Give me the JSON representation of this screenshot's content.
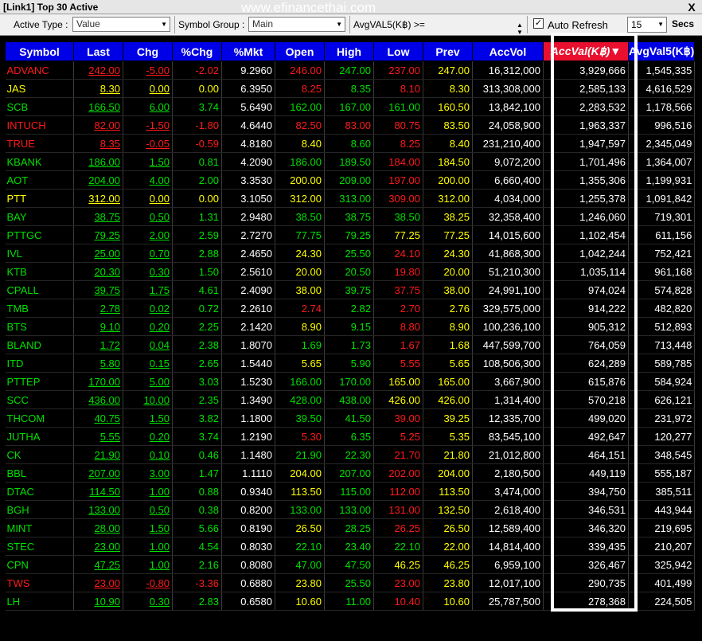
{
  "window": {
    "title": "[Link1] Top 30 Active",
    "watermark": "www.efinancethai.com",
    "close_label": "X"
  },
  "toolbar": {
    "active_type_label": "Active Type :",
    "active_type_value": "Value",
    "symbol_group_label": "Symbol Group :",
    "symbol_group_value": "Main",
    "avgval_label": "AvgVAL5(K฿) >=",
    "auto_refresh_label": "Auto Refresh",
    "auto_refresh_checked": "✓",
    "refresh_secs_value": "15",
    "secs_label": "Secs"
  },
  "colors": {
    "up": "#00e000",
    "down": "#ff1a1a",
    "unchanged": "#ffff00",
    "header_bg": "#0000e6",
    "selected_header_bg": "#e8102e"
  },
  "table": {
    "columns": [
      "Symbol",
      "Last",
      "Chg",
      "%Chg",
      "%Mkt",
      "Open",
      "High",
      "Low",
      "Prev",
      "AccVol",
      "AccVal(K฿)",
      "AvgVal5(K฿)"
    ],
    "sorted_column_arrow": "▼",
    "rows": [
      {
        "symbol": "ADVANC",
        "last": "242.00",
        "chg": "-5.00",
        "pchg": "-2.02",
        "pmkt": "9.2960",
        "open": "246.00",
        "high": "247.00",
        "low": "237.00",
        "prev": "247.00",
        "accvol": "16,312,000",
        "accval": "3,929,666",
        "avgval5": "1,545,335",
        "c": {
          "symbol": "d",
          "last": "d",
          "open": "d",
          "high": "u",
          "low": "d"
        }
      },
      {
        "symbol": "JAS",
        "last": "8.30",
        "chg": "0.00",
        "pchg": "0.00",
        "pmkt": "6.3950",
        "open": "8.25",
        "high": "8.35",
        "low": "8.10",
        "prev": "8.30",
        "accvol": "313,308,000",
        "accval": "2,585,133",
        "avgval5": "4,616,529",
        "c": {
          "symbol": "n",
          "last": "n",
          "open": "d",
          "high": "g",
          "low": "d"
        }
      },
      {
        "symbol": "SCB",
        "last": "166.50",
        "chg": "6.00",
        "pchg": "3.74",
        "pmkt": "5.6490",
        "open": "162.00",
        "high": "167.00",
        "low": "161.00",
        "prev": "160.50",
        "accvol": "13,842,100",
        "accval": "2,283,532",
        "avgval5": "1,178,566",
        "c": {
          "symbol": "g",
          "last": "g",
          "open": "g",
          "high": "g",
          "low": "g"
        }
      },
      {
        "symbol": "INTUCH",
        "last": "82.00",
        "chg": "-1.50",
        "pchg": "-1.80",
        "pmkt": "4.6440",
        "open": "82.50",
        "high": "83.00",
        "low": "80.75",
        "prev": "83.50",
        "accvol": "24,058,900",
        "accval": "1,963,337",
        "avgval5": "996,516",
        "c": {
          "symbol": "d",
          "last": "d",
          "open": "d",
          "high": "d",
          "low": "d"
        }
      },
      {
        "symbol": "TRUE",
        "last": "8.35",
        "chg": "-0.05",
        "pchg": "-0.59",
        "pmkt": "4.8180",
        "open": "8.40",
        "high": "8.60",
        "low": "8.25",
        "prev": "8.40",
        "accvol": "231,210,400",
        "accval": "1,947,597",
        "avgval5": "2,345,049",
        "c": {
          "symbol": "d",
          "last": "d",
          "open": "n",
          "high": "g",
          "low": "d"
        }
      },
      {
        "symbol": "KBANK",
        "last": "186.00",
        "chg": "1.50",
        "pchg": "0.81",
        "pmkt": "4.2090",
        "open": "186.00",
        "high": "189.50",
        "low": "184.00",
        "prev": "184.50",
        "accvol": "9,072,200",
        "accval": "1,701,496",
        "avgval5": "1,364,007",
        "c": {
          "symbol": "g",
          "last": "g",
          "open": "g",
          "high": "g",
          "low": "d"
        }
      },
      {
        "symbol": "AOT",
        "last": "204.00",
        "chg": "4.00",
        "pchg": "2.00",
        "pmkt": "3.3530",
        "open": "200.00",
        "high": "209.00",
        "low": "197.00",
        "prev": "200.00",
        "accvol": "6,660,400",
        "accval": "1,355,306",
        "avgval5": "1,199,931",
        "c": {
          "symbol": "g",
          "last": "g",
          "open": "n",
          "high": "g",
          "low": "d"
        }
      },
      {
        "symbol": "PTT",
        "last": "312.00",
        "chg": "0.00",
        "pchg": "0.00",
        "pmkt": "3.1050",
        "open": "312.00",
        "high": "313.00",
        "low": "309.00",
        "prev": "312.00",
        "accvol": "4,034,000",
        "accval": "1,255,378",
        "avgval5": "1,091,842",
        "c": {
          "symbol": "n",
          "last": "n",
          "open": "n",
          "high": "g",
          "low": "d"
        }
      },
      {
        "symbol": "BAY",
        "last": "38.75",
        "chg": "0.50",
        "pchg": "1.31",
        "pmkt": "2.9480",
        "open": "38.50",
        "high": "38.75",
        "low": "38.50",
        "prev": "38.25",
        "accvol": "32,358,400",
        "accval": "1,246,060",
        "avgval5": "719,301",
        "c": {
          "symbol": "g",
          "last": "g",
          "open": "g",
          "high": "g",
          "low": "g"
        }
      },
      {
        "symbol": "PTTGC",
        "last": "79.25",
        "chg": "2.00",
        "pchg": "2.59",
        "pmkt": "2.7270",
        "open": "77.75",
        "high": "79.25",
        "low": "77.25",
        "prev": "77.25",
        "accvol": "14,015,600",
        "accval": "1,102,454",
        "avgval5": "611,156",
        "c": {
          "symbol": "g",
          "last": "g",
          "open": "g",
          "high": "g",
          "low": "n"
        }
      },
      {
        "symbol": "IVL",
        "last": "25.00",
        "chg": "0.70",
        "pchg": "2.88",
        "pmkt": "2.4650",
        "open": "24.30",
        "high": "25.50",
        "low": "24.10",
        "prev": "24.30",
        "accvol": "41,868,300",
        "accval": "1,042,244",
        "avgval5": "752,421",
        "c": {
          "symbol": "g",
          "last": "g",
          "open": "n",
          "high": "g",
          "low": "d"
        }
      },
      {
        "symbol": "KTB",
        "last": "20.30",
        "chg": "0.30",
        "pchg": "1.50",
        "pmkt": "2.5610",
        "open": "20.00",
        "high": "20.50",
        "low": "19.80",
        "prev": "20.00",
        "accvol": "51,210,300",
        "accval": "1,035,114",
        "avgval5": "961,168",
        "c": {
          "symbol": "g",
          "last": "g",
          "open": "n",
          "high": "g",
          "low": "d"
        }
      },
      {
        "symbol": "CPALL",
        "last": "39.75",
        "chg": "1.75",
        "pchg": "4.61",
        "pmkt": "2.4090",
        "open": "38.00",
        "high": "39.75",
        "low": "37.75",
        "prev": "38.00",
        "accvol": "24,991,100",
        "accval": "974,024",
        "avgval5": "574,828",
        "c": {
          "symbol": "g",
          "last": "g",
          "open": "n",
          "high": "g",
          "low": "d"
        }
      },
      {
        "symbol": "TMB",
        "last": "2.78",
        "chg": "0.02",
        "pchg": "0.72",
        "pmkt": "2.2610",
        "open": "2.74",
        "high": "2.82",
        "low": "2.70",
        "prev": "2.76",
        "accvol": "329,575,000",
        "accval": "914,222",
        "avgval5": "482,820",
        "c": {
          "symbol": "g",
          "last": "g",
          "open": "d",
          "high": "g",
          "low": "d"
        }
      },
      {
        "symbol": "BTS",
        "last": "9.10",
        "chg": "0.20",
        "pchg": "2.25",
        "pmkt": "2.1420",
        "open": "8.90",
        "high": "9.15",
        "low": "8.80",
        "prev": "8.90",
        "accvol": "100,236,100",
        "accval": "905,312",
        "avgval5": "512,893",
        "c": {
          "symbol": "g",
          "last": "g",
          "open": "n",
          "high": "g",
          "low": "d"
        }
      },
      {
        "symbol": "BLAND",
        "last": "1.72",
        "chg": "0.04",
        "pchg": "2.38",
        "pmkt": "1.8070",
        "open": "1.69",
        "high": "1.73",
        "low": "1.67",
        "prev": "1.68",
        "accvol": "447,599,700",
        "accval": "764,059",
        "avgval5": "713,448",
        "c": {
          "symbol": "g",
          "last": "g",
          "open": "g",
          "high": "g",
          "low": "d"
        }
      },
      {
        "symbol": "ITD",
        "last": "5.80",
        "chg": "0.15",
        "pchg": "2.65",
        "pmkt": "1.5440",
        "open": "5.65",
        "high": "5.90",
        "low": "5.55",
        "prev": "5.65",
        "accvol": "108,506,300",
        "accval": "624,289",
        "avgval5": "589,785",
        "c": {
          "symbol": "g",
          "last": "g",
          "open": "n",
          "high": "g",
          "low": "d"
        }
      },
      {
        "symbol": "PTTEP",
        "last": "170.00",
        "chg": "5.00",
        "pchg": "3.03",
        "pmkt": "1.5230",
        "open": "166.00",
        "high": "170.00",
        "low": "165.00",
        "prev": "165.00",
        "accvol": "3,667,900",
        "accval": "615,876",
        "avgval5": "584,924",
        "c": {
          "symbol": "g",
          "last": "g",
          "open": "g",
          "high": "g",
          "low": "n"
        }
      },
      {
        "symbol": "SCC",
        "last": "436.00",
        "chg": "10.00",
        "pchg": "2.35",
        "pmkt": "1.3490",
        "open": "428.00",
        "high": "438.00",
        "low": "426.00",
        "prev": "426.00",
        "accvol": "1,314,400",
        "accval": "570,218",
        "avgval5": "626,121",
        "c": {
          "symbol": "g",
          "last": "g",
          "open": "g",
          "high": "g",
          "low": "n"
        }
      },
      {
        "symbol": "THCOM",
        "last": "40.75",
        "chg": "1.50",
        "pchg": "3.82",
        "pmkt": "1.1800",
        "open": "39.50",
        "high": "41.50",
        "low": "39.00",
        "prev": "39.25",
        "accvol": "12,335,700",
        "accval": "499,020",
        "avgval5": "231,972",
        "c": {
          "symbol": "g",
          "last": "g",
          "open": "g",
          "high": "g",
          "low": "d"
        }
      },
      {
        "symbol": "JUTHA",
        "last": "5.55",
        "chg": "0.20",
        "pchg": "3.74",
        "pmkt": "1.2190",
        "open": "5.30",
        "high": "6.35",
        "low": "5.25",
        "prev": "5.35",
        "accvol": "83,545,100",
        "accval": "492,647",
        "avgval5": "120,277",
        "c": {
          "symbol": "g",
          "last": "g",
          "open": "d",
          "high": "g",
          "low": "d"
        }
      },
      {
        "symbol": "CK",
        "last": "21.90",
        "chg": "0.10",
        "pchg": "0.46",
        "pmkt": "1.1480",
        "open": "21.90",
        "high": "22.30",
        "low": "21.70",
        "prev": "21.80",
        "accvol": "21,012,800",
        "accval": "464,151",
        "avgval5": "348,545",
        "c": {
          "symbol": "g",
          "last": "g",
          "open": "g",
          "high": "g",
          "low": "d"
        }
      },
      {
        "symbol": "BBL",
        "last": "207.00",
        "chg": "3.00",
        "pchg": "1.47",
        "pmkt": "1.1110",
        "open": "204.00",
        "high": "207.00",
        "low": "202.00",
        "prev": "204.00",
        "accvol": "2,180,500",
        "accval": "449,119",
        "avgval5": "555,187",
        "c": {
          "symbol": "g",
          "last": "g",
          "open": "n",
          "high": "g",
          "low": "d"
        }
      },
      {
        "symbol": "DTAC",
        "last": "114.50",
        "chg": "1.00",
        "pchg": "0.88",
        "pmkt": "0.9340",
        "open": "113.50",
        "high": "115.00",
        "low": "112.00",
        "prev": "113.50",
        "accvol": "3,474,000",
        "accval": "394,750",
        "avgval5": "385,511",
        "c": {
          "symbol": "g",
          "last": "g",
          "open": "n",
          "high": "g",
          "low": "d"
        }
      },
      {
        "symbol": "BGH",
        "last": "133.00",
        "chg": "0.50",
        "pchg": "0.38",
        "pmkt": "0.8200",
        "open": "133.00",
        "high": "133.00",
        "low": "131.00",
        "prev": "132.50",
        "accvol": "2,618,400",
        "accval": "346,531",
        "avgval5": "443,944",
        "c": {
          "symbol": "g",
          "last": "g",
          "open": "g",
          "high": "g",
          "low": "d"
        }
      },
      {
        "symbol": "MINT",
        "last": "28.00",
        "chg": "1.50",
        "pchg": "5.66",
        "pmkt": "0.8190",
        "open": "26.50",
        "high": "28.25",
        "low": "26.25",
        "prev": "26.50",
        "accvol": "12,589,400",
        "accval": "346,320",
        "avgval5": "219,695",
        "c": {
          "symbol": "g",
          "last": "g",
          "open": "n",
          "high": "g",
          "low": "d"
        }
      },
      {
        "symbol": "STEC",
        "last": "23.00",
        "chg": "1.00",
        "pchg": "4.54",
        "pmkt": "0.8030",
        "open": "22.10",
        "high": "23.40",
        "low": "22.10",
        "prev": "22.00",
        "accvol": "14,814,400",
        "accval": "339,435",
        "avgval5": "210,207",
        "c": {
          "symbol": "g",
          "last": "g",
          "open": "g",
          "high": "g",
          "low": "g"
        }
      },
      {
        "symbol": "CPN",
        "last": "47.25",
        "chg": "1.00",
        "pchg": "2.16",
        "pmkt": "0.8080",
        "open": "47.00",
        "high": "47.50",
        "low": "46.25",
        "prev": "46.25",
        "accvol": "6,959,100",
        "accval": "326,467",
        "avgval5": "325,942",
        "c": {
          "symbol": "g",
          "last": "g",
          "open": "g",
          "high": "g",
          "low": "n"
        }
      },
      {
        "symbol": "TWS",
        "last": "23.00",
        "chg": "-0.80",
        "pchg": "-3.36",
        "pmkt": "0.6880",
        "open": "23.80",
        "high": "25.50",
        "low": "23.00",
        "prev": "23.80",
        "accvol": "12,017,100",
        "accval": "290,735",
        "avgval5": "401,499",
        "c": {
          "symbol": "d",
          "last": "d",
          "open": "n",
          "high": "g",
          "low": "d"
        }
      },
      {
        "symbol": "LH",
        "last": "10.90",
        "chg": "0.30",
        "pchg": "2.83",
        "pmkt": "0.6580",
        "open": "10.60",
        "high": "11.00",
        "low": "10.40",
        "prev": "10.60",
        "accvol": "25,787,500",
        "accval": "278,368",
        "avgval5": "224,505",
        "c": {
          "symbol": "g",
          "last": "g",
          "open": "n",
          "high": "g",
          "low": "d"
        }
      }
    ]
  }
}
